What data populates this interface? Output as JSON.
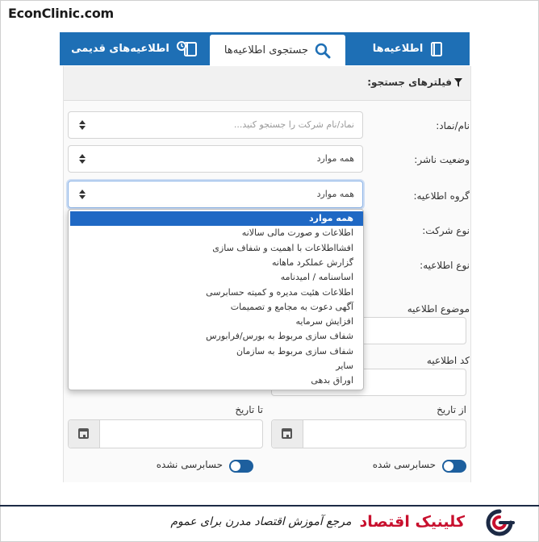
{
  "site_logo": "EconClinic.com",
  "tabs": {
    "announcements": "اطلاعیه‌ها",
    "search": "جستجوی اطلاعیه‌ها",
    "old": "اطلاعیه‌های قدیمی"
  },
  "filters": {
    "title": "فیلترهای جستجو:",
    "symbol_label": "نام/نماد:",
    "symbol_placeholder": "نماد/نام شرکت را جستجو کنید...",
    "publisher_status_label": "وضعیت ناشر:",
    "publisher_status_value": "همه موارد",
    "group_label": "گروه اطلاعیه:",
    "group_value": "همه موارد",
    "company_type_label": "نوع شرکت:",
    "announcement_type_label": "نوع اطلاعیه:",
    "subject_label": "موضوع اطلاعیه",
    "code_label": "کد اطلاعیه",
    "from_date_label": "از تاریخ",
    "to_date_label": "تا تاریخ",
    "audited_label": "حسابرسی شده",
    "unaudited_label": "حسابرسی نشده"
  },
  "dropdown": {
    "options": [
      "همه موارد",
      "اطلاعات و صورت مالی سالانه",
      "افشااطلاعات با اهمیت و شفاف سازی",
      "گزارش عملکرد ماهانه",
      "اساسنامه / امیدنامه",
      "اطلاعات هئیت مدیره و کمیته حسابرسی",
      "آگهی دعوت به مجامع و تصمیمات",
      "افزایش سرمایه",
      "شفاف سازی مربوط به بورس/فرابورس",
      "شفاف سازی مربوط به سازمان",
      "سایر",
      "اوراق بدهی"
    ],
    "selected_index": 0
  },
  "footer": {
    "brand": "کلینیک اقتصاد",
    "tagline": "مرجع آموزش اقتصاد مدرن برای عموم"
  },
  "colors": {
    "tab_bar": "#1e6fb5",
    "selected_option": "#1f68c4",
    "toggle": "#1d5f9e",
    "brand_red": "#c8102e"
  }
}
